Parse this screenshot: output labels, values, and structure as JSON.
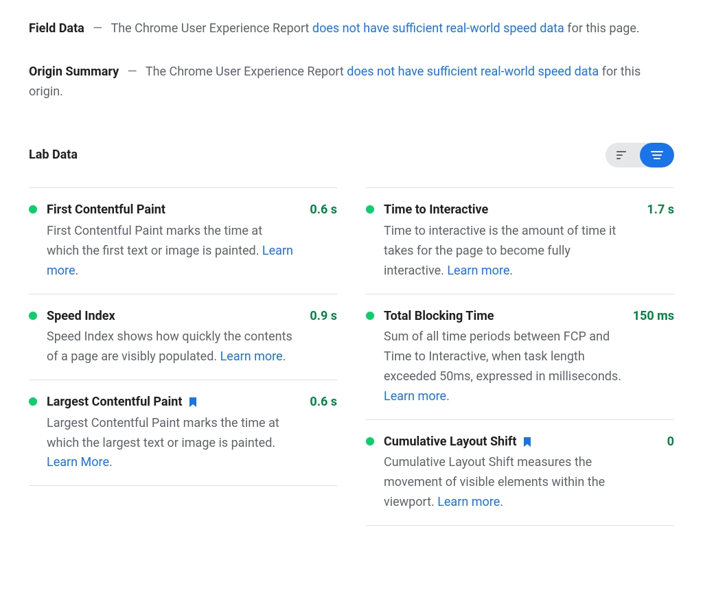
{
  "field_data": {
    "title": "Field Data",
    "text_pre": "The Chrome User Experience Report ",
    "link": "does not have sufficient real-world speed data",
    "text_post": " for this page."
  },
  "origin_summary": {
    "title": "Origin Summary",
    "text_pre": "The Chrome User Experience Report ",
    "link": "does not have sufficient real-world speed data",
    "text_post": " for this origin."
  },
  "lab": {
    "title": "Lab Data",
    "learn_more": "Learn more",
    "learn_more_alt": "Learn More",
    "left": [
      {
        "name": "First Contentful Paint",
        "value": "0.6 s",
        "desc": "First Contentful Paint marks the time at which the first text or image is painted. ",
        "link": "Learn more",
        "flag": false
      },
      {
        "name": "Speed Index",
        "value": "0.9 s",
        "desc": "Speed Index shows how quickly the contents of a page are visibly populated. ",
        "link": "Learn more",
        "flag": false
      },
      {
        "name": "Largest Contentful Paint",
        "value": "0.6 s",
        "desc": "Largest Contentful Paint marks the time at which the largest text or image is painted. ",
        "link": "Learn More",
        "flag": true
      }
    ],
    "right": [
      {
        "name": "Time to Interactive",
        "value": "1.7 s",
        "desc": "Time to interactive is the amount of time it takes for the page to become fully interactive. ",
        "link": "Learn more",
        "flag": false
      },
      {
        "name": "Total Blocking Time",
        "value": "150 ms",
        "desc": "Sum of all time periods between FCP and Time to Interactive, when task length exceeded 50ms, expressed in milliseconds. ",
        "link": "Learn more",
        "flag": false
      },
      {
        "name": "Cumulative Layout Shift",
        "value": "0",
        "desc": "Cumulative Layout Shift measures the movement of visible elements within the viewport. ",
        "link": "Learn more",
        "flag": true
      }
    ]
  },
  "colors": {
    "link": "#1a73e8",
    "good": "#0cce6b",
    "value_good": "#018642"
  }
}
